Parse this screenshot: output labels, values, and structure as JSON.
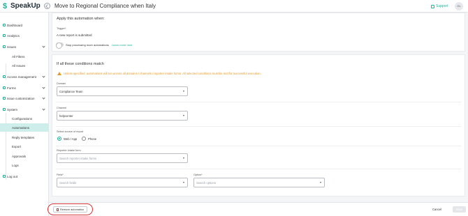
{
  "header": {
    "brand": "SpeakUp",
    "title": "Move to Regional Compliance when Italy",
    "support_label": "Support",
    "avatar_initials": "GL"
  },
  "sidebar": {
    "items": [
      {
        "label": "Dashboard",
        "icon": "dashboard-icon"
      },
      {
        "label": "Analytics",
        "icon": "analytics-icon"
      },
      {
        "label": "Issues",
        "icon": "issues-icon",
        "expanded": true
      },
      {
        "label": "All Filters",
        "sub": true
      },
      {
        "label": "All Issues",
        "sub": true
      },
      {
        "label": "Access management",
        "icon": "access-icon"
      },
      {
        "label": "Forms",
        "icon": "forms-icon"
      },
      {
        "label": "Issue customization",
        "icon": "customization-icon"
      },
      {
        "label": "System",
        "icon": "system-icon",
        "expanded": true
      },
      {
        "label": "Configurations",
        "sub": true
      },
      {
        "label": "Automations",
        "sub": true,
        "active": true
      },
      {
        "label": "Reply templates",
        "sub": true
      },
      {
        "label": "Export",
        "sub": true
      },
      {
        "label": "Approvals",
        "sub": true
      },
      {
        "label": "Logs",
        "sub": true
      },
      {
        "label": "Log out",
        "icon": "logout-icon"
      }
    ]
  },
  "trigger_section": {
    "title": "Apply this automation when:",
    "trigger_label": "Trigger*",
    "trigger_value": "A new report is submitted",
    "toggle_label": "Stop processing more automations",
    "learn_more": "Learn more here"
  },
  "conditions_section": {
    "title": "If all these conditions match",
    "warning": "Unless specified, automations will run across all domains / channels / reporter intake forms. All selected conditions must be met for successful execution.",
    "domain_label": "Domain",
    "domain_value": "Compliance Team",
    "channel_label": "Channel",
    "channel_value": "helpcenter",
    "source_label": "Select source of report",
    "source_options": [
      "Web / App",
      "Phone"
    ],
    "source_selected": "Web / App",
    "intake_label": "Reporter intake form",
    "intake_placeholder": "Search reporter intake forms",
    "field_label": "Field*",
    "field_placeholder": "Search fields",
    "option_label": "Option*",
    "option_placeholder": "Search options"
  },
  "footer": {
    "remove_label": "Remove automation",
    "cancel_label": "Cancel",
    "save_label": "Save"
  },
  "colors": {
    "accent": "#19b39b",
    "warning": "#e39b2b",
    "highlight": "#d6363b"
  }
}
